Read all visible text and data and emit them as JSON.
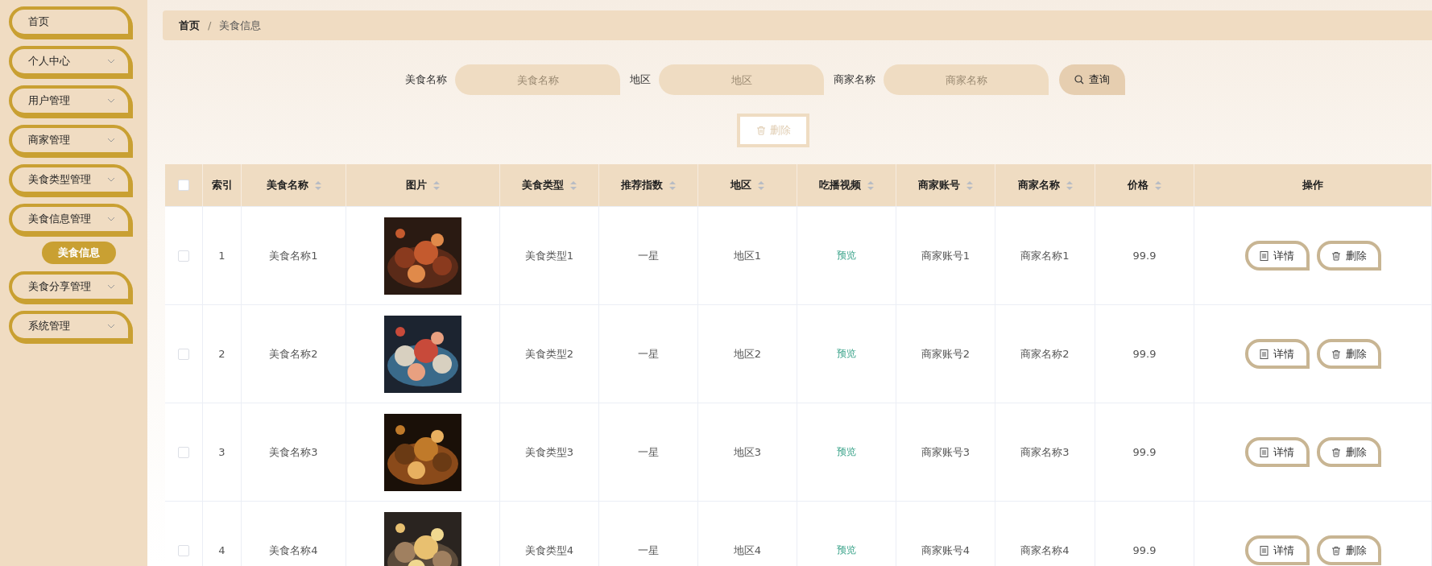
{
  "sidebar": {
    "items": [
      {
        "label": "首页",
        "kind": "link"
      },
      {
        "label": "个人中心",
        "kind": "submenu"
      },
      {
        "label": "用户管理",
        "kind": "submenu"
      },
      {
        "label": "商家管理",
        "kind": "submenu"
      },
      {
        "label": "美食类型管理",
        "kind": "submenu"
      },
      {
        "label": "美食信息管理",
        "kind": "submenu",
        "children": [
          {
            "label": "美食信息",
            "selected": true
          }
        ]
      },
      {
        "label": "美食分享管理",
        "kind": "submenu"
      },
      {
        "label": "系统管理",
        "kind": "submenu"
      }
    ]
  },
  "breadcrumb": {
    "separator": "/",
    "items": [
      "首页",
      "美食信息"
    ]
  },
  "search": {
    "fields": [
      {
        "label": "美食名称",
        "placeholder": "美食名称"
      },
      {
        "label": "地区",
        "placeholder": "地区"
      },
      {
        "label": "商家名称",
        "placeholder": "商家名称"
      }
    ],
    "button": "查询"
  },
  "batch_delete": {
    "label": "删除",
    "disabled": true
  },
  "table": {
    "select_all": {
      "checked": false
    },
    "columns": [
      {
        "label": "索引",
        "sortable": false
      },
      {
        "label": "美食名称",
        "sortable": true
      },
      {
        "label": "图片",
        "sortable": true
      },
      {
        "label": "美食类型",
        "sortable": true
      },
      {
        "label": "推荐指数",
        "sortable": true
      },
      {
        "label": "地区",
        "sortable": true
      },
      {
        "label": "吃播视频",
        "sortable": true
      },
      {
        "label": "商家账号",
        "sortable": true
      },
      {
        "label": "商家名称",
        "sortable": true
      },
      {
        "label": "价格",
        "sortable": true
      },
      {
        "label": "操作",
        "sortable": false
      }
    ],
    "rows": [
      {
        "checked": false,
        "index": "1",
        "name": "美食名称1",
        "image": {
          "kind": "picture"
        },
        "type": "美食类型1",
        "rating": "一星",
        "region": "地区1",
        "video": "预览",
        "account": "商家账号1",
        "merchant": "商家名称1",
        "price": "99.9",
        "actions": [
          "详情",
          "删除"
        ]
      },
      {
        "checked": false,
        "index": "2",
        "name": "美食名称2",
        "image": {
          "kind": "picture"
        },
        "type": "美食类型2",
        "rating": "一星",
        "region": "地区2",
        "video": "预览",
        "account": "商家账号2",
        "merchant": "商家名称2",
        "price": "99.9",
        "actions": [
          "详情",
          "删除"
        ]
      },
      {
        "checked": false,
        "index": "3",
        "name": "美食名称3",
        "image": {
          "kind": "picture"
        },
        "type": "美食类型3",
        "rating": "一星",
        "region": "地区3",
        "video": "预览",
        "account": "商家账号3",
        "merchant": "商家名称3",
        "price": "99.9",
        "actions": [
          "详情",
          "删除"
        ]
      },
      {
        "checked": false,
        "index": "4",
        "name": "美食名称4",
        "image": {
          "kind": "picture"
        },
        "type": "美食类型4",
        "rating": "一星",
        "region": "地区4",
        "video": "预览",
        "account": "商家账号4",
        "merchant": "商家名称4",
        "price": "99.9",
        "actions": [
          "详情",
          "删除"
        ]
      }
    ]
  }
}
